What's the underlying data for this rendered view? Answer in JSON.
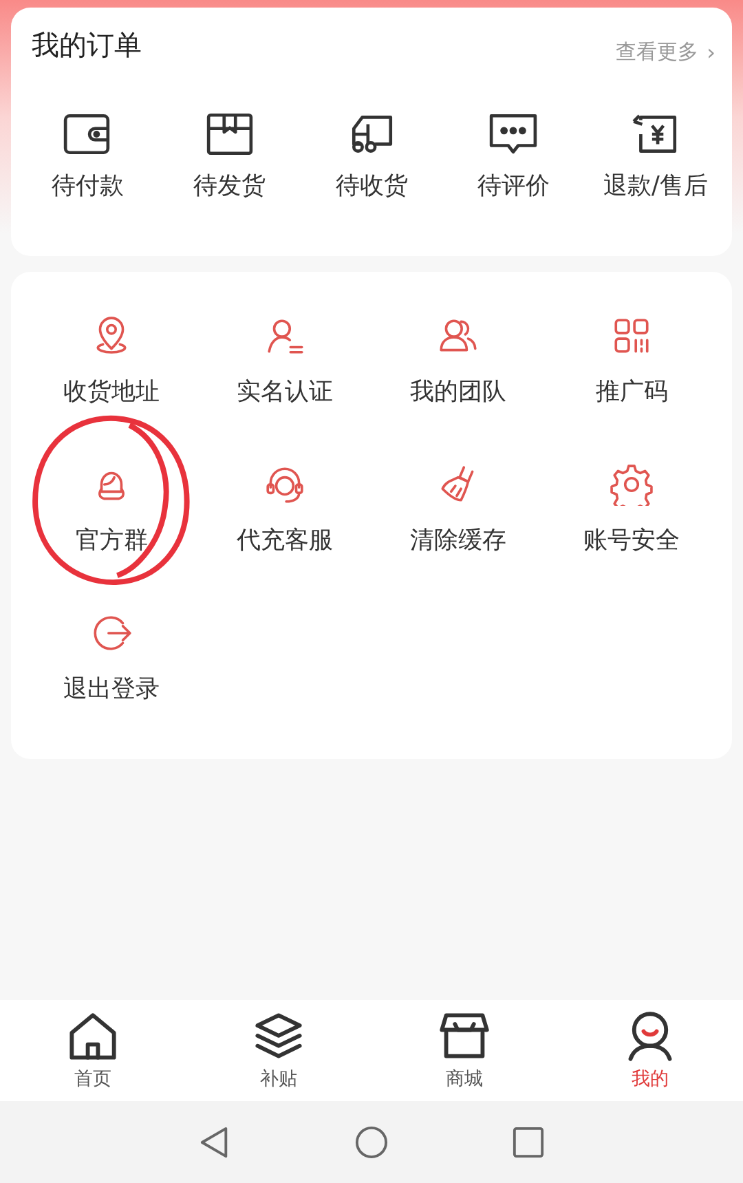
{
  "orders": {
    "title": "我的订单",
    "more": "查看更多",
    "more_arrow": "›",
    "items": [
      {
        "label": "待付款"
      },
      {
        "label": "待发货"
      },
      {
        "label": "待收货"
      },
      {
        "label": "待评价"
      },
      {
        "label": "退款/售后"
      }
    ]
  },
  "menu": {
    "items": [
      {
        "label": "收货地址",
        "circled": false
      },
      {
        "label": "实名认证",
        "circled": false
      },
      {
        "label": "我的团队",
        "circled": false
      },
      {
        "label": "推广码",
        "circled": false
      },
      {
        "label": "官方群",
        "circled": true
      },
      {
        "label": "代充客服",
        "circled": false
      },
      {
        "label": "清除缓存",
        "circled": false
      },
      {
        "label": "账号安全",
        "circled": false
      },
      {
        "label": "退出登录",
        "circled": false
      }
    ]
  },
  "tab_bar": [
    {
      "label": "首页",
      "selected": false
    },
    {
      "label": "补贴",
      "selected": false
    },
    {
      "label": "商城",
      "selected": false
    },
    {
      "label": "我的",
      "selected": true
    }
  ]
}
